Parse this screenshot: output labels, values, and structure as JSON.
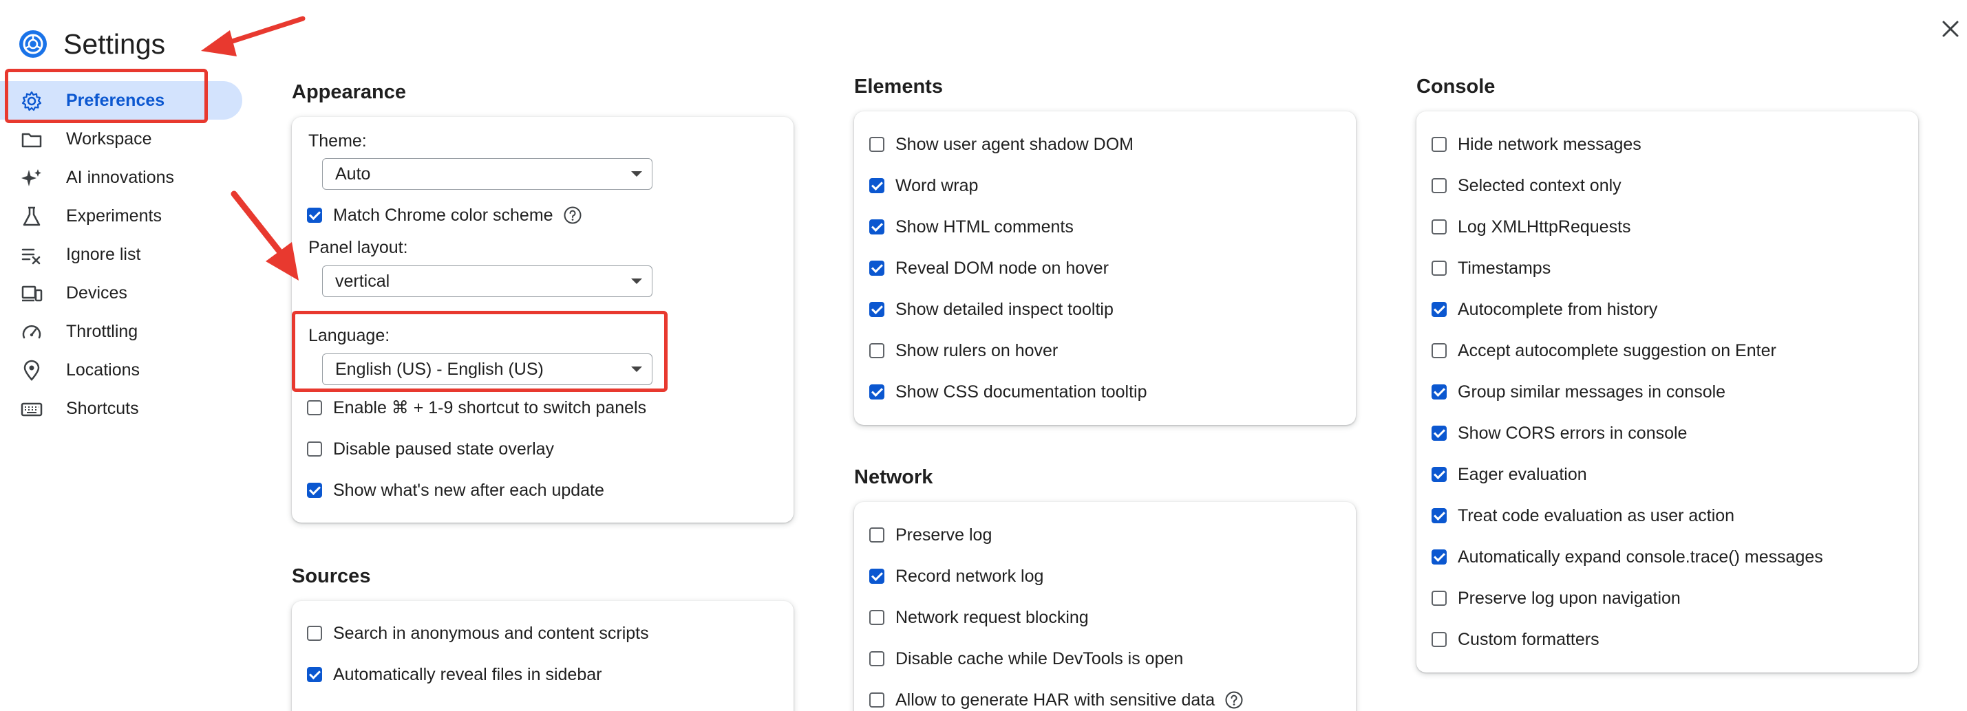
{
  "header": {
    "title": "Settings"
  },
  "colors": {
    "accent": "#0b57d0",
    "selected_bg": "#d3e3fd",
    "annotation": "#e8392f"
  },
  "sidebar": {
    "items": [
      {
        "label": "Preferences",
        "icon": "gear-icon",
        "selected": true
      },
      {
        "label": "Workspace",
        "icon": "folder-icon"
      },
      {
        "label": "AI innovations",
        "icon": "sparkle-icon"
      },
      {
        "label": "Experiments",
        "icon": "flask-icon"
      },
      {
        "label": "Ignore list",
        "icon": "ignore-list-icon"
      },
      {
        "label": "Devices",
        "icon": "devices-icon"
      },
      {
        "label": "Throttling",
        "icon": "gauge-icon"
      },
      {
        "label": "Locations",
        "icon": "location-pin-icon"
      },
      {
        "label": "Shortcuts",
        "icon": "keyboard-icon"
      }
    ]
  },
  "appearance": {
    "title": "Appearance",
    "theme_label": "Theme:",
    "theme_value": "Auto",
    "match_chrome": "Match Chrome color scheme",
    "panel_layout_label": "Panel layout:",
    "panel_layout_value": "vertical",
    "language_label": "Language:",
    "language_value": "English (US) - English (US)",
    "options": [
      {
        "label": "Enable ⌘ + 1-9 shortcut to switch panels",
        "checked": false
      },
      {
        "label": "Disable paused state overlay",
        "checked": false
      },
      {
        "label": "Show what's new after each update",
        "checked": true
      }
    ]
  },
  "sources": {
    "title": "Sources",
    "options": [
      {
        "label": "Search in anonymous and content scripts",
        "checked": false
      },
      {
        "label": "Automatically reveal files in sidebar",
        "checked": true
      }
    ]
  },
  "elements": {
    "title": "Elements",
    "options": [
      {
        "label": "Show user agent shadow DOM",
        "checked": false
      },
      {
        "label": "Word wrap",
        "checked": true
      },
      {
        "label": "Show HTML comments",
        "checked": true
      },
      {
        "label": "Reveal DOM node on hover",
        "checked": true
      },
      {
        "label": "Show detailed inspect tooltip",
        "checked": true
      },
      {
        "label": "Show rulers on hover",
        "checked": false
      },
      {
        "label": "Show CSS documentation tooltip",
        "checked": true
      }
    ]
  },
  "network": {
    "title": "Network",
    "options": [
      {
        "label": "Preserve log",
        "checked": false
      },
      {
        "label": "Record network log",
        "checked": true
      },
      {
        "label": "Network request blocking",
        "checked": false
      },
      {
        "label": "Disable cache while DevTools is open",
        "checked": false
      },
      {
        "label": "Allow to generate HAR with sensitive data",
        "checked": false
      }
    ]
  },
  "console": {
    "title": "Console",
    "options": [
      {
        "label": "Hide network messages",
        "checked": false
      },
      {
        "label": "Selected context only",
        "checked": false
      },
      {
        "label": "Log XMLHttpRequests",
        "checked": false
      },
      {
        "label": "Timestamps",
        "checked": false
      },
      {
        "label": "Autocomplete from history",
        "checked": true
      },
      {
        "label": "Accept autocomplete suggestion on Enter",
        "checked": false
      },
      {
        "label": "Group similar messages in console",
        "checked": true
      },
      {
        "label": "Show CORS errors in console",
        "checked": true
      },
      {
        "label": "Eager evaluation",
        "checked": true
      },
      {
        "label": "Treat code evaluation as user action",
        "checked": true
      },
      {
        "label": "Automatically expand console.trace() messages",
        "checked": true
      },
      {
        "label": "Preserve log upon navigation",
        "checked": false
      },
      {
        "label": "Custom formatters",
        "checked": false
      }
    ]
  }
}
